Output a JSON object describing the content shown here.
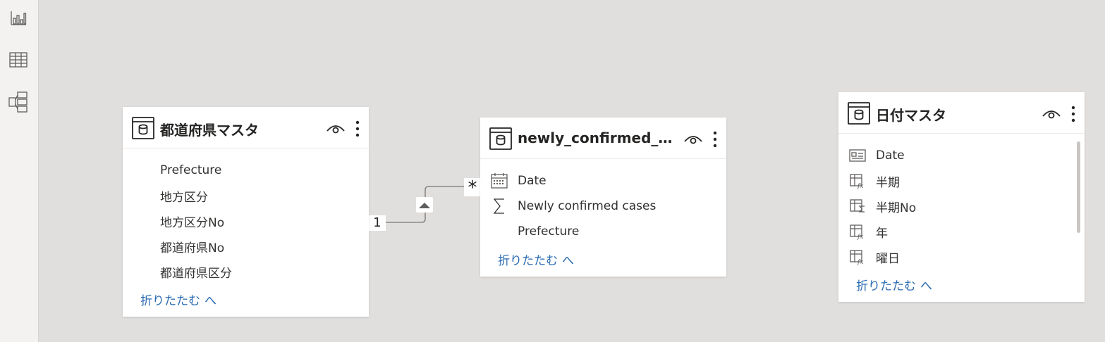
{
  "sidebar": {
    "items": [
      {
        "icon": "report-view-icon"
      },
      {
        "icon": "data-view-icon"
      },
      {
        "icon": "model-view-icon"
      }
    ]
  },
  "tables": [
    {
      "title": "都道府県マスタ",
      "fields": [
        {
          "label": "Prefecture",
          "icon": "none"
        },
        {
          "label": "地方区分",
          "icon": "none"
        },
        {
          "label": "地方区分No",
          "icon": "none"
        },
        {
          "label": "都道府県No",
          "icon": "none"
        },
        {
          "label": "都道府県区分",
          "icon": "none"
        }
      ],
      "collapse_label": "折りたたむ",
      "collapse_chevron": "へ"
    },
    {
      "title": "newly_confirmed_cas...",
      "fields": [
        {
          "label": "Date",
          "icon": "calendar-icon"
        },
        {
          "label": "Newly confirmed cases",
          "icon": "sigma-icon"
        },
        {
          "label": "Prefecture",
          "icon": "none"
        }
      ],
      "collapse_label": "折りたたむ",
      "collapse_chevron": "へ"
    },
    {
      "title": "日付マスタ",
      "fields": [
        {
          "label": "Date",
          "icon": "id-card-icon"
        },
        {
          "label": "半期",
          "icon": "calculated-column-icon"
        },
        {
          "label": "半期No",
          "icon": "calculated-sum-column-icon"
        },
        {
          "label": "年",
          "icon": "calculated-column-icon"
        },
        {
          "label": "曜日",
          "icon": "calculated-column-icon"
        }
      ],
      "collapse_label": "折りたたむ",
      "collapse_chevron": "へ"
    }
  ],
  "relationship": {
    "from_cardinality": "1",
    "to_cardinality": "*",
    "direction_icon": "filter-direction-arrow-icon"
  },
  "colors": {
    "canvas": "#e1dfdd",
    "sidebar": "#f3f2f1",
    "card": "#ffffff",
    "link": "#2b6cb3",
    "text": "#323130"
  }
}
